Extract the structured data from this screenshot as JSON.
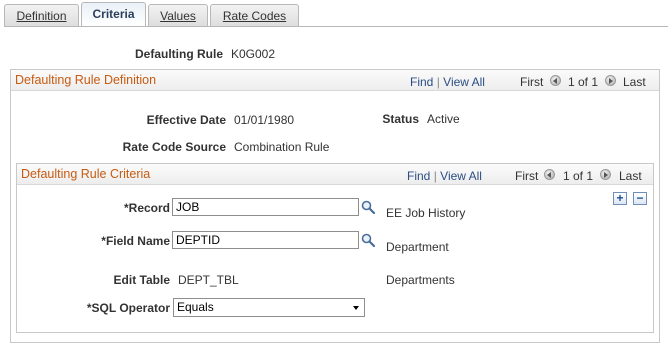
{
  "tabs": [
    {
      "label": "Definition",
      "active": false
    },
    {
      "label": "Criteria",
      "active": true
    },
    {
      "label": "Values",
      "active": false
    },
    {
      "label": "Rate Codes",
      "active": false
    }
  ],
  "header": {
    "defaulting_rule_label": "Defaulting Rule",
    "defaulting_rule_value": "K0G002"
  },
  "definition_box": {
    "title": "Defaulting Rule Definition",
    "find": "Find",
    "separator": "|",
    "view_all": "View All",
    "first": "First",
    "count": "1 of 1",
    "last": "Last",
    "effective_date_label": "Effective Date",
    "effective_date_value": "01/01/1980",
    "status_label": "Status",
    "status_value": "Active",
    "rate_code_source_label": "Rate Code Source",
    "rate_code_source_value": "Combination Rule"
  },
  "criteria_box": {
    "title": "Defaulting Rule Criteria",
    "find": "Find",
    "separator": "|",
    "view_all": "View All",
    "first": "First",
    "count": "1 of 1",
    "last": "Last",
    "add_symbol": "+",
    "delete_symbol": "−",
    "record_label": "*Record",
    "record_value": "JOB",
    "record_description": "EE Job History",
    "field_name_label": "*Field Name",
    "field_name_value": "DEPTID",
    "field_name_description": "Department",
    "edit_table_label": "Edit Table",
    "edit_table_value": "DEPT_TBL",
    "edit_table_description": "Departments",
    "sql_operator_label": "*SQL Operator",
    "sql_operator_value": "Equals"
  },
  "icons": {
    "lookup": "magnifier-icon",
    "prev": "arrow-left-icon",
    "next": "arrow-right-icon"
  },
  "colors": {
    "section_title": "#c75b12",
    "link": "#2a4e84"
  }
}
